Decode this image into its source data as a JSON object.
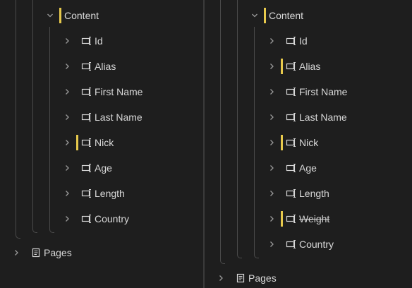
{
  "left": {
    "content_label": "Content",
    "fields": [
      {
        "label": "Id",
        "marked": false
      },
      {
        "label": "Alias",
        "marked": false
      },
      {
        "label": "First Name",
        "marked": false
      },
      {
        "label": "Last Name",
        "marked": false
      },
      {
        "label": "Nick",
        "marked": true
      },
      {
        "label": "Age",
        "marked": false
      },
      {
        "label": "Length",
        "marked": false
      },
      {
        "label": "Country",
        "marked": false
      }
    ],
    "pages_label": "Pages"
  },
  "right": {
    "content_label": "Content",
    "fields": [
      {
        "label": "Id",
        "marked": false
      },
      {
        "label": "Alias",
        "marked": true
      },
      {
        "label": "First Name",
        "marked": false
      },
      {
        "label": "Last Name",
        "marked": false
      },
      {
        "label": "Nick",
        "marked": true
      },
      {
        "label": "Age",
        "marked": false
      },
      {
        "label": "Length",
        "marked": false
      },
      {
        "label": "Weight",
        "marked": true,
        "removed": true
      },
      {
        "label": "Country",
        "marked": false
      }
    ],
    "pages_label": "Pages"
  },
  "colors": {
    "background": "#1e1e1e",
    "change_marker": "#e7c94c",
    "guide_line": "#4a4a4a",
    "text": "#d8d8d8"
  },
  "icons": {
    "expand": "chevron-right-icon",
    "collapse": "chevron-down-icon",
    "field": "field-icon",
    "pages": "document-icon"
  }
}
